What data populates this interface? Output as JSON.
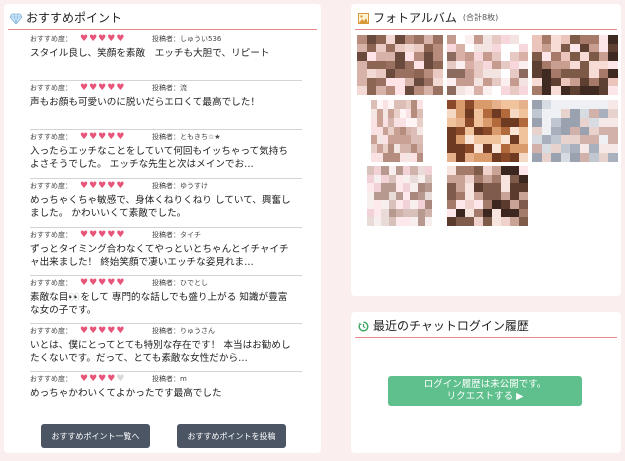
{
  "recommend": {
    "title": "おすすめポイント",
    "items": [
      {
        "label": "おすすめ度：",
        "stars": 5,
        "poster": "投稿者：しゅうい536",
        "text": "スタイル良し、笑顔を素敵　エッチも大胆で、リピート"
      },
      {
        "label": "おすすめ度：",
        "stars": 5,
        "poster": "投稿者：流",
        "text": "声もお顔も可愛いのに脱いだらエロくて最高でした！"
      },
      {
        "label": "おすすめ度：",
        "stars": 5,
        "poster": "投稿者：ともきち☆★",
        "text": "入ったらエッチなことをしていて何回もイッちゃって気持ち\nよさそうでした。 エッチな先生と次はメインでお…"
      },
      {
        "label": "おすすめ度：",
        "stars": 5,
        "poster": "投稿者：ゆうすけ",
        "text": "めっちゃくちゃ敏感で、身体くねりくねり していて、興奮し\nました。 かわいいくて素敵でした。"
      },
      {
        "label": "おすすめ度：",
        "stars": 5,
        "poster": "投稿者：タイチ",
        "text": "ずっとタイミング合わなくてやっといとちゃんとイチャイチ\nャ出来ました！ 終始笑顔で凄いエッチな姿見れま…"
      },
      {
        "label": "おすすめ度：",
        "stars": 5,
        "poster": "投稿者：ひでとし",
        "text": "素敵な目👀をして 専門的な話しでも盛り上がる 知識が豊富\nな女の子です。"
      },
      {
        "label": "おすすめ度：",
        "stars": 5,
        "poster": "投稿者：りゅうさん",
        "text": "いとは、僕にとってとても特別な存在です！ 本当はお勧めし\nたくないです。だって、とても素敵な女性だから…"
      },
      {
        "label": "おすすめ度：",
        "stars": 4,
        "poster": "投稿者：m",
        "text": "めっちゃかわいくてよかったです最高でした"
      }
    ],
    "btn_list": "おすすめポイント一覧へ",
    "btn_post": "おすすめポイントを投稿"
  },
  "album": {
    "title": "フォトアルバム",
    "count": "(合計8枚)"
  },
  "chat": {
    "title": "最近のチャットログイン履歴",
    "btn_line1": "ログイン履歴は未公開です。",
    "btn_line2": "リクエストする ▶"
  },
  "colors": {
    "accent_rule": "#e88a8a",
    "heart": "#e8557a",
    "button_dark": "#4b5563",
    "button_green": "#5fc08e"
  }
}
